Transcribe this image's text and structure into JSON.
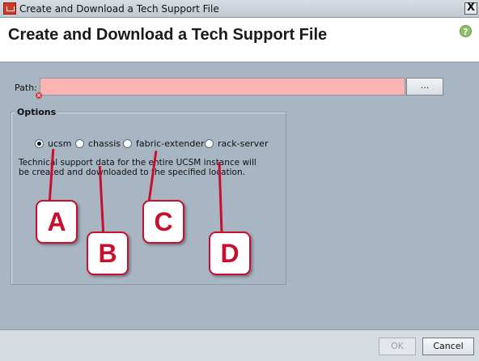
{
  "window": {
    "title": "Create and Download a Tech Support File",
    "close_glyph": "X",
    "icon": "app-icon"
  },
  "header": {
    "title": "Create and Download a Tech Support File",
    "help_glyph": "?",
    "help_icon": "help-icon"
  },
  "path": {
    "label": "Path:",
    "value": "",
    "browse_label": "...",
    "error_icon": "error-icon",
    "error_color": "#fbb3b3"
  },
  "options": {
    "legend": "Options",
    "selected": "ucsm",
    "radios": [
      {
        "label": "ucsm",
        "checked": true
      },
      {
        "label": "chassis",
        "checked": false
      },
      {
        "label": "fabric-extender",
        "checked": false
      },
      {
        "label": "rack-server",
        "checked": false
      }
    ],
    "description": "Technical support data for the entire UCSM instance will be created and downloaded to the specified location."
  },
  "callouts": [
    {
      "label": "A"
    },
    {
      "label": "B"
    },
    {
      "label": "C"
    },
    {
      "label": "D"
    }
  ],
  "footer": {
    "ok_label": "OK",
    "cancel_label": "Cancel"
  },
  "colors": {
    "callout": "#c8102e",
    "background": "#a8b5c2"
  }
}
